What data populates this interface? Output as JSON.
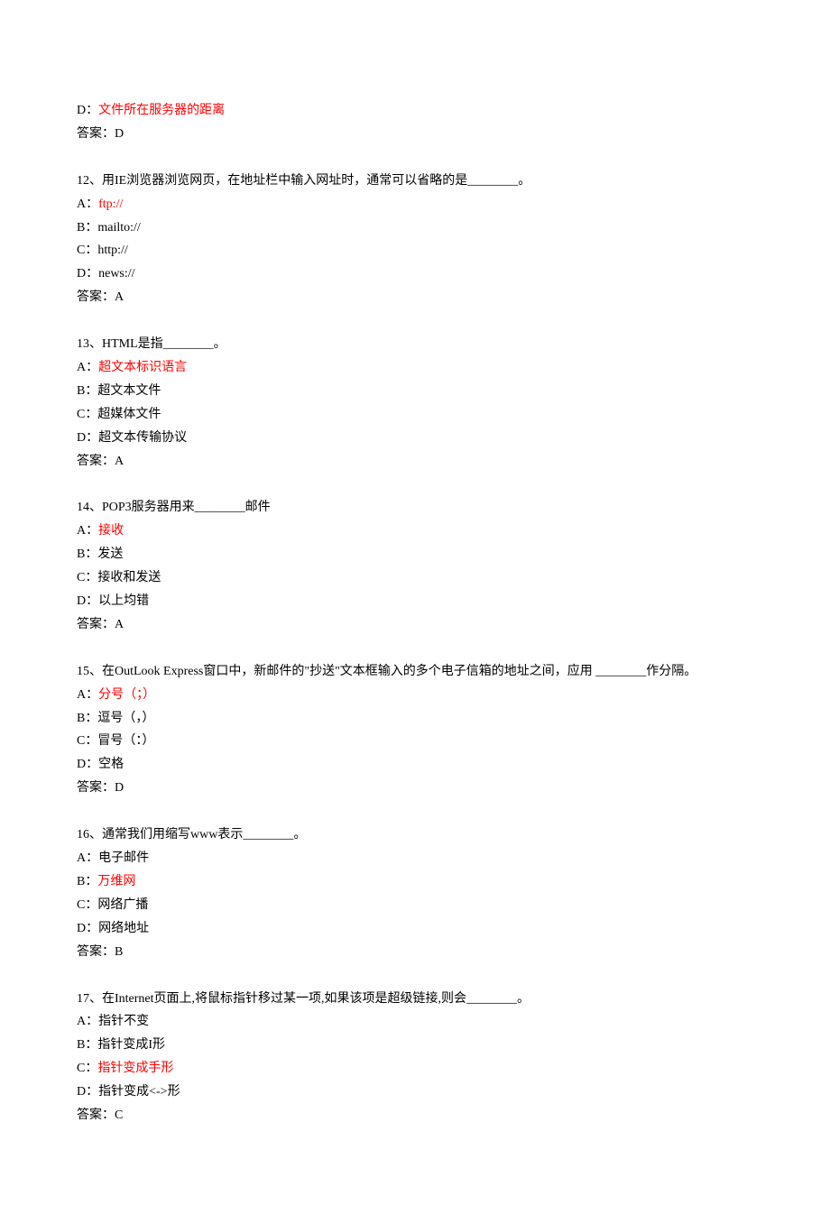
{
  "q11_tail": {
    "optD_prefix": "D：",
    "optD_text": "文件所在服务器的距离",
    "answer": "答案：D"
  },
  "q12": {
    "question": "12、用IE浏览器浏览网页，在地址栏中输入网址时，通常可以省略的是________。",
    "optA_prefix": "A：",
    "optA_text": "ftp://",
    "optB": "B：mailto://",
    "optC": "C：http://",
    "optD": "D：news://",
    "answer": "答案：A"
  },
  "q13": {
    "question": "13、HTML是指________。",
    "optA_prefix": "A：",
    "optA_text": "超文本标识语言",
    "optB": "B：超文本文件",
    "optC": "C：超媒体文件",
    "optD": "D：超文本传输协议",
    "answer": "答案：A"
  },
  "q14": {
    "question": "14、POP3服务器用来________邮件",
    "optA_prefix": "A：",
    "optA_text": "接收",
    "optB": "B：发送",
    "optC": "C：接收和发送",
    "optD": "D：以上均错",
    "answer": "答案：A"
  },
  "q15": {
    "question": "15、在OutLook Express窗口中，新邮件的\"抄送\"文本框输入的多个电子信箱的地址之间，应用 ________作分隔。",
    "optA_prefix": "A：",
    "optA_text": "分号（；）",
    "optB": "B：逗号（，）",
    "optC": "C：冒号（：）",
    "optD": "D：空格",
    "answer": "答案：D"
  },
  "q16": {
    "question": "16、通常我们用缩写www表示________。",
    "optA": "A：电子邮件",
    "optB_prefix": "B：",
    "optB_text": "万维网",
    "optC": "C：网络广播",
    "optD": "D：网络地址",
    "answer": "答案：B"
  },
  "q17": {
    "question": "17、在Internet页面上,将鼠标指针移过某一项,如果该项是超级链接,则会________。",
    "optA": "A：指针不变",
    "optB": "B：指针变成I形",
    "optC_prefix": "C：",
    "optC_text": "指针变成手形",
    "optD": "D：指针变成<->形",
    "answer": "答案：C"
  }
}
